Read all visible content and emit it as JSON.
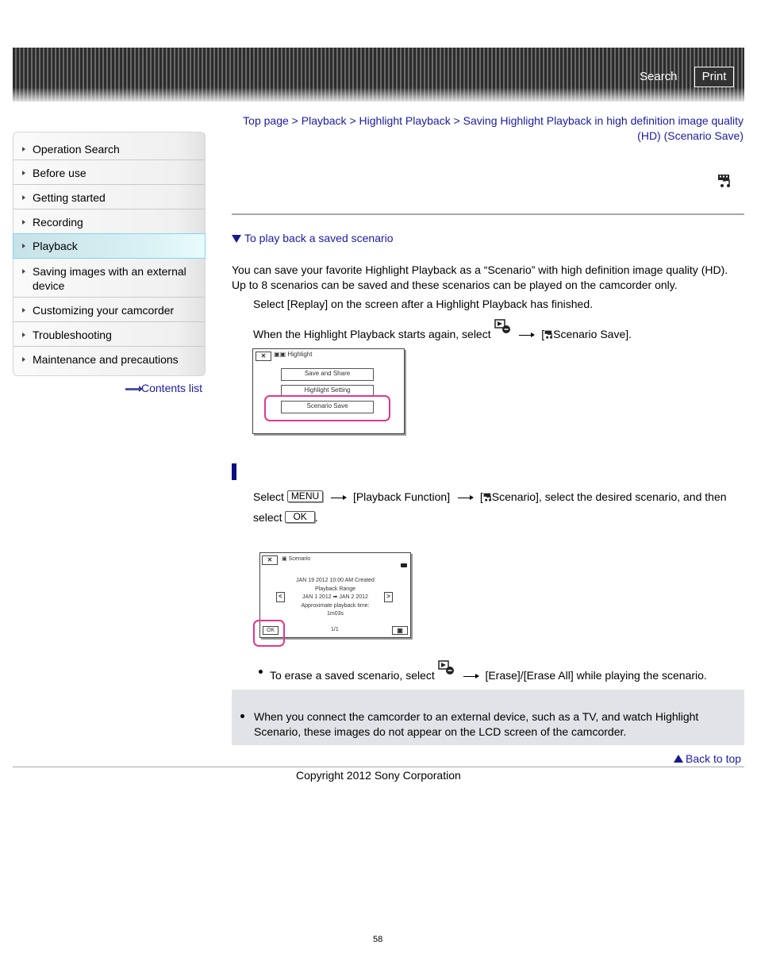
{
  "header": {
    "search_label": "Search",
    "print_label": "Print"
  },
  "sidebar": {
    "items": [
      {
        "label": "Operation Search",
        "active": false
      },
      {
        "label": "Before use",
        "active": false
      },
      {
        "label": "Getting started",
        "active": false
      },
      {
        "label": "Recording",
        "active": false
      },
      {
        "label": "Playback",
        "active": true
      },
      {
        "label": "Saving images with an external device",
        "active": false
      },
      {
        "label": "Customizing your camcorder",
        "active": false
      },
      {
        "label": "Troubleshooting",
        "active": false
      },
      {
        "label": "Maintenance and precautions",
        "active": false
      }
    ],
    "contents_link": "Contents list"
  },
  "breadcrumb": {
    "items": [
      "Top page",
      "Playback",
      "Highlight Playback",
      "Saving Highlight Playback in high definition image quality (HD) (Scenario Save)"
    ],
    "separator": ">"
  },
  "title_icon": "scenario-icon",
  "section_link": "To play back a saved scenario",
  "intro": "You can save your favorite Highlight Playback as a “Scenario” with high definition image quality (HD). Up to 8 scenarios can be saved and these scenarios can be played on the camcorder only.",
  "steps": {
    "step1": "Select [Replay] on the screen after a Highlight Playback has finished.",
    "step2_pre": "When the Highlight Playback starts again, select",
    "step2_post": "[",
    "step2_target": "Scenario Save]."
  },
  "screen1": {
    "close": "✕",
    "title": "Highlight",
    "buttons": [
      "Save and Share",
      "Highlight Setting",
      "Scenario Save"
    ]
  },
  "section2": {
    "select": "Select",
    "menu_btn": "MENU",
    "playback_function": "[Playback Function]",
    "scenario_pre": "[",
    "scenario": "Scenario], select the desired scenario, and then",
    "select2": "select",
    "ok_btn": "OK",
    "period": "."
  },
  "screen2": {
    "close": "✕",
    "title": "Scenario",
    "created": "JAN 19 2012 10:00 AM Created",
    "range_label": "Playback Range",
    "range": "JAN  1 2012 ➡ JAN  2 2012",
    "time_label": "Approximate playback time:",
    "time": "1m03s",
    "ok": "OK",
    "page": "1/1",
    "prev": "<",
    "next": ">"
  },
  "erase_note": {
    "pre": "To erase a saved scenario, select",
    "post": "[Erase]/[Erase All] while playing the scenario."
  },
  "note": "When you connect the camcorder to an external device, such as a TV, and watch Highlight Scenario, these images do not appear on the LCD screen of the camcorder.",
  "back_to_top": "Back to top",
  "copyright": "Copyright 2012 Sony Corporation",
  "page_number": "58"
}
